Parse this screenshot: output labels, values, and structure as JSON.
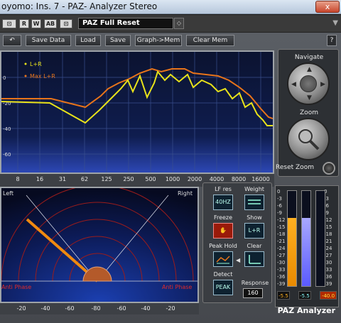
{
  "window": {
    "title": "oyomo: Ins. 7 - PAZ- Analyzer Stereo",
    "close_label": "x"
  },
  "host": {
    "buttons": [
      "⊡",
      "R",
      "W",
      "AB",
      "⊡"
    ],
    "preset": "PAZ Full Reset",
    "preset_nav": "◇",
    "dropdown": "▼"
  },
  "toolbar": {
    "undo": "↶",
    "save_data": "Save Data",
    "load": "Load",
    "save": "Save",
    "graph_mem": "Graph->Mem",
    "clear_mem": "Clear Mem",
    "help": "?"
  },
  "graph": {
    "legend": [
      {
        "label": "L+R",
        "color": "#e8e21a"
      },
      {
        "label": "Max L+R",
        "color": "#e8741a"
      }
    ],
    "y_ticks": [
      "0",
      "-20",
      "-40",
      "-60"
    ],
    "freq_ticks": [
      "8",
      "16",
      "31",
      "62",
      "125",
      "250",
      "500",
      "1000",
      "2000",
      "4000",
      "8000",
      "16000"
    ]
  },
  "navigate": {
    "navigate_label": "Navigate",
    "zoom_label": "Zoom",
    "reset_zoom_label": "Reset Zoom"
  },
  "stereo": {
    "left_label": "Left",
    "right_label": "Right",
    "anti_phase_left": "Anti Phase",
    "anti_phase_right": "Anti Phase",
    "correlation_ticks": [
      "-20",
      "-40",
      "-60",
      "-80",
      "-60",
      "-40",
      "-20"
    ]
  },
  "controls": {
    "lf_res": "LF res",
    "lf_res_value": "40HZ",
    "weight": "Weight",
    "freeze": "Freeze",
    "show": "Show",
    "show_value": "L+R",
    "peak_hold": "Peak Hold",
    "clear": "Clear",
    "detect": "Detect",
    "detect_value": "PEAK",
    "response": "Response",
    "response_value": "160"
  },
  "levels": {
    "scale": [
      "0",
      "-3",
      "-6",
      "-9",
      "-12",
      "-15",
      "-18",
      "-21",
      "-24",
      "-27",
      "-30",
      "-33",
      "-36",
      "-39"
    ],
    "left_value": "-5.5",
    "mid_value": "-5.5",
    "right_value": "-40.0",
    "left_level": 0.72,
    "mid_level": 0.72,
    "right_level": 0.0
  },
  "brand": "PAZ Analyzer"
}
